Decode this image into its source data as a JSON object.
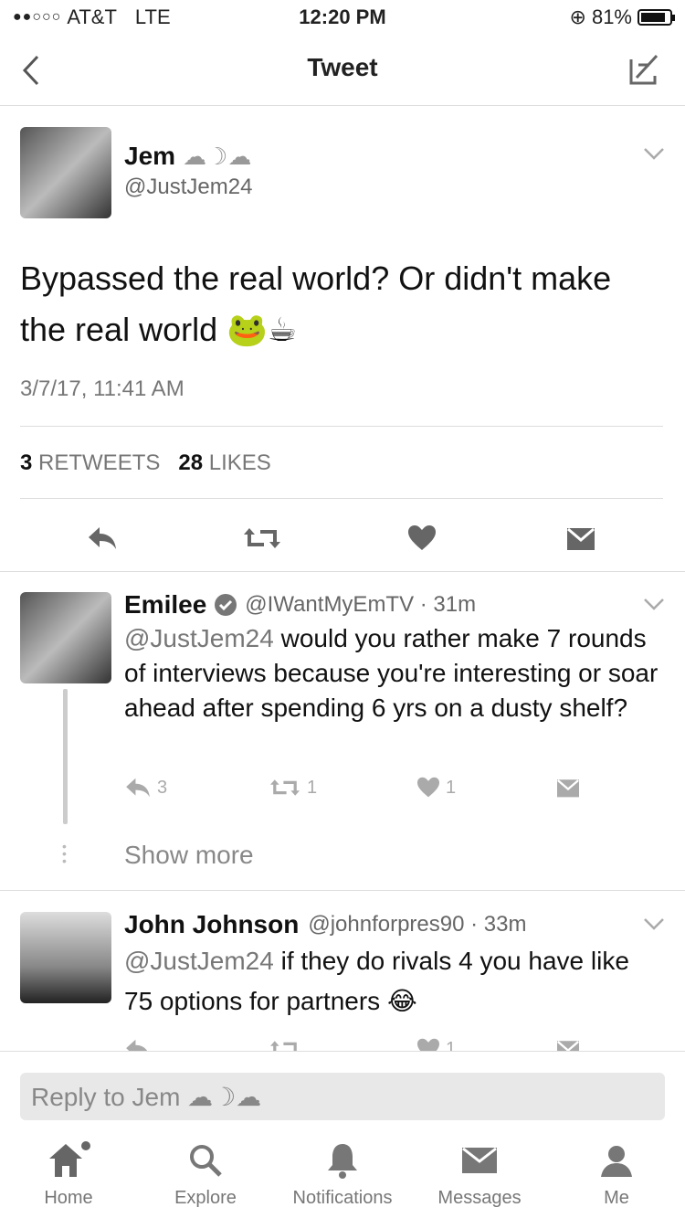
{
  "status": {
    "carrier": "AT&T",
    "network": "LTE",
    "time": "12:20 PM",
    "battery": "81%"
  },
  "nav": {
    "title": "Tweet"
  },
  "tweet": {
    "name": "Jem",
    "name_emoji": "☁☽☁",
    "handle": "@JustJem24",
    "text": "Bypassed the real world? Or didn't make the real world 🐸☕",
    "date": "3/7/17, 11:41 AM",
    "retweets_count": "3",
    "retweets_label": "RETWEETS",
    "likes_count": "28",
    "likes_label": "LIKES"
  },
  "replies": [
    {
      "name": "Emilee",
      "handle_time": "@IWantMyEmTV · 31m",
      "mention": "@JustJem24",
      "text": " would you rather make 7 rounds of interviews because you're interesting or soar ahead after spending 6 yrs on a dusty shelf?",
      "reply_count": "3",
      "retweet_count": "1",
      "like_count": "1",
      "show_more": "Show more"
    },
    {
      "name": "John Johnson",
      "handle_time": "@johnforpres90 · 33m",
      "mention": "@JustJem24",
      "text": " if they do rivals 4 you have like 75 options for partners 😂",
      "like_count": "1"
    }
  ],
  "composer": {
    "placeholder": "Reply to Jem ☁☽☁"
  },
  "tabs": [
    {
      "label": "Home"
    },
    {
      "label": "Explore"
    },
    {
      "label": "Notifications"
    },
    {
      "label": "Messages"
    },
    {
      "label": "Me"
    }
  ]
}
